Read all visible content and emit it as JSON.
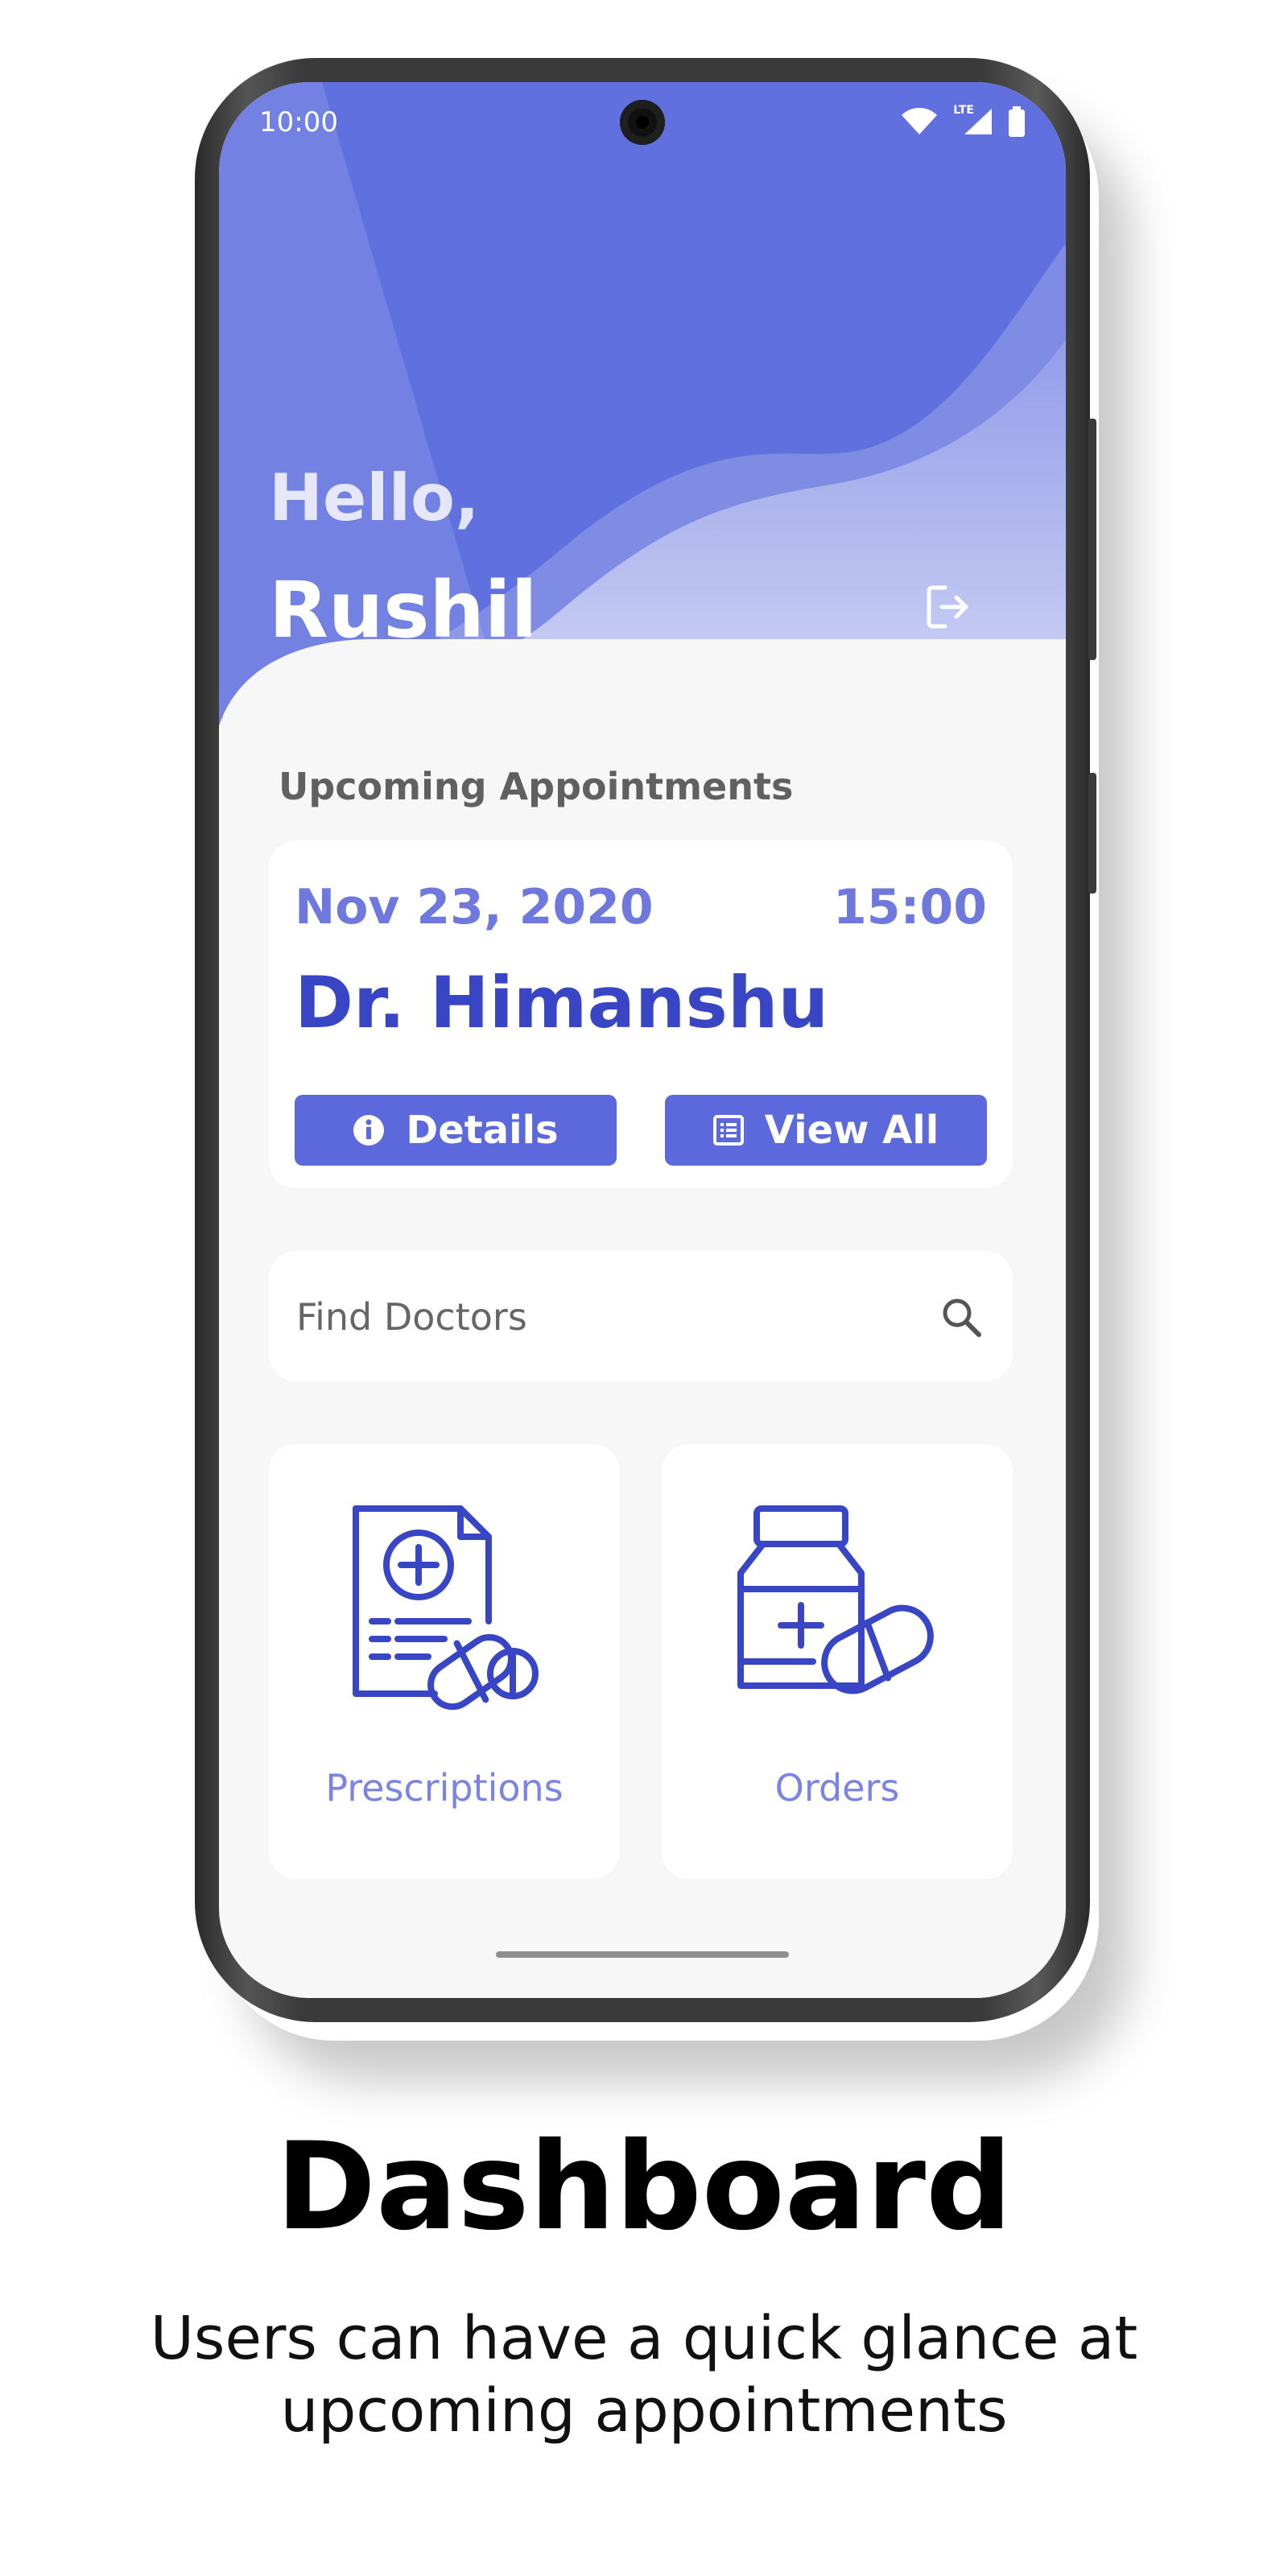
{
  "status_bar": {
    "time": "10:00",
    "network_label": "LTE"
  },
  "header": {
    "hello": "Hello,",
    "name": "Rushil"
  },
  "appointments": {
    "section_title": "Upcoming Appointments",
    "date": "Nov 23, 2020",
    "time": "15:00",
    "doctor": "Dr. Himanshu",
    "details_label": "Details",
    "view_all_label": "View All"
  },
  "search": {
    "placeholder": "Find Doctors"
  },
  "tiles": [
    {
      "label": "Prescriptions",
      "icon": "prescription-icon"
    },
    {
      "label": "Orders",
      "icon": "medicine-bottle-icon"
    }
  ],
  "caption": {
    "title": "Dashboard",
    "subtitle_line1": "Users can have a quick glance at",
    "subtitle_line2": "upcoming appointments"
  },
  "colors": {
    "header_primary": "#6070de",
    "accent_blue": "#3845c5",
    "button_blue": "#5b69dc",
    "label_light_blue": "#7b84e3",
    "screen_bg": "#f7f7f8"
  }
}
